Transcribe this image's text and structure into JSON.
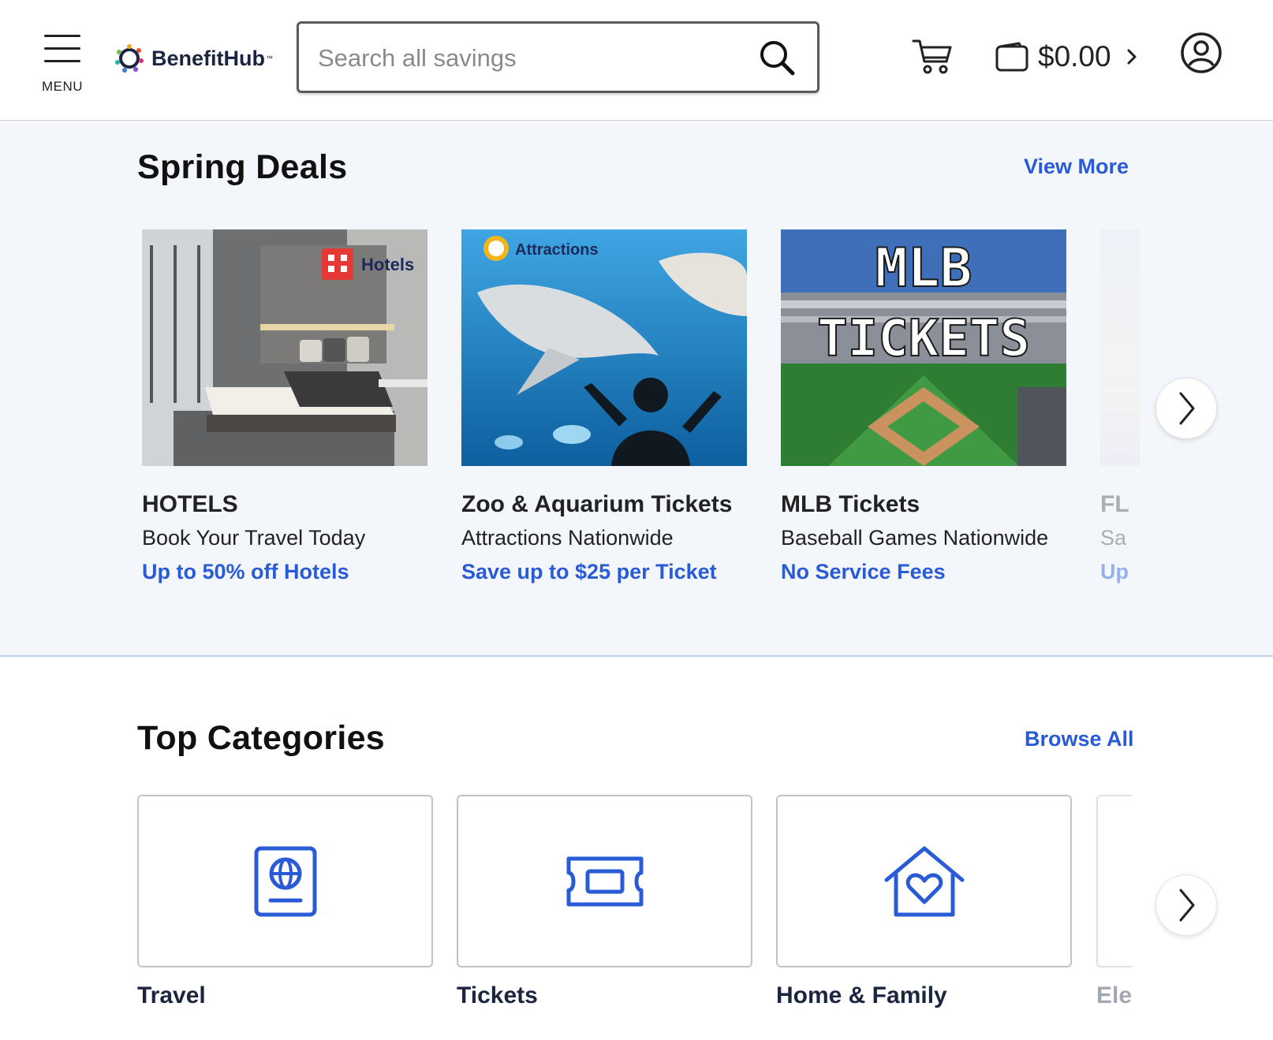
{
  "header": {
    "menu_label": "MENU",
    "logo_text": "BenefitHub",
    "logo_tm": "™",
    "search_placeholder": "Search all savings",
    "wallet_amount": "$0.00"
  },
  "spring_deals": {
    "title": "Spring Deals",
    "view_more": "View More",
    "cards": [
      {
        "image_badge": "Hotels",
        "name": "HOTELS",
        "subtitle": "Book Your Travel Today",
        "offer": "Up to 50% off Hotels"
      },
      {
        "image_badge": "Attractions",
        "name": "Zoo & Aquarium Tickets",
        "subtitle": "Attractions Nationwide",
        "offer": "Save up to $25 per Ticket"
      },
      {
        "image_line1": "MLB",
        "image_line2": "TICKETS",
        "name": "MLB Tickets",
        "subtitle": "Baseball Games Nationwide",
        "offer": "No Service Fees"
      },
      {
        "name": "FL",
        "subtitle": "Sa",
        "offer": "Up"
      }
    ]
  },
  "top_categories": {
    "title": "Top Categories",
    "browse_all": "Browse All",
    "items": [
      {
        "label": "Travel",
        "icon": "passport-globe-icon"
      },
      {
        "label": "Tickets",
        "icon": "ticket-icon"
      },
      {
        "label": "Home & Family",
        "icon": "house-heart-icon"
      },
      {
        "label": "Ele",
        "icon": ""
      }
    ]
  },
  "colors": {
    "accent": "#2a5bd7",
    "section_bg": "#f3f7fc",
    "heading": "#111111"
  }
}
